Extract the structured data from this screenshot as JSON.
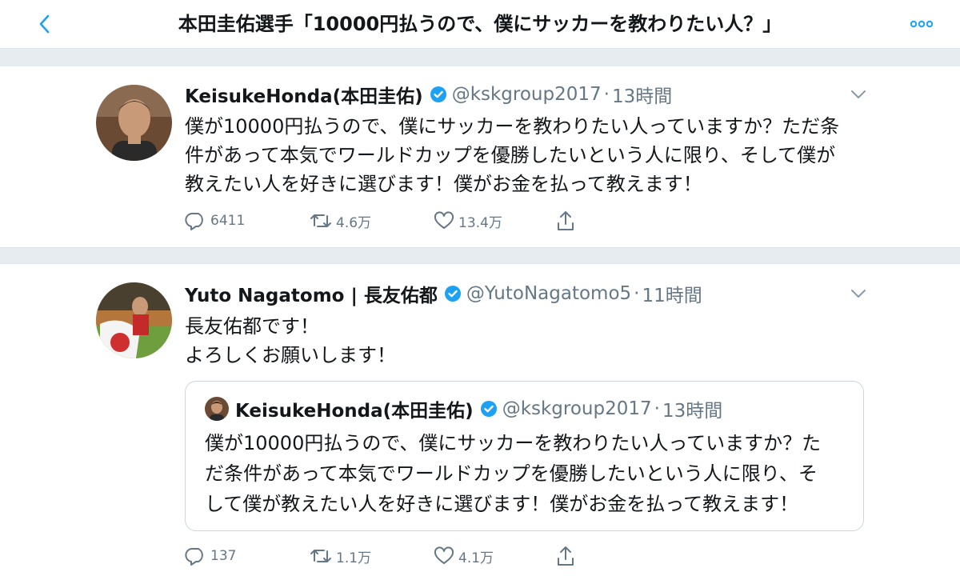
{
  "header": {
    "title": "本田圭佑選手「10000円払うので、僕にサッカーを教わりたい人？」",
    "back_icon": "chevron-left-icon",
    "more_icon": "more-dots-icon",
    "accent": "#1da1f2"
  },
  "tweets": [
    {
      "name": "KeisukeHonda(本田圭佑)",
      "handle": "@kskgroup2017",
      "separator": "·",
      "time": "13時間",
      "lines": [
        "僕が10000円払うので、僕にサッカーを教わりたい人っていますか？ただ条",
        "件があって本気でワールドカップを優勝したいという人に限り、そして僕が",
        "教えたい人を好きに選びます！僕がお金を払って教えます！"
      ],
      "replies": "6411",
      "retweets": "4.6万",
      "likes": "13.4万"
    },
    {
      "name": "Yuto Nagatomo | 長友佑都",
      "handle": "@YutoNagatomo5",
      "separator": "·",
      "time": "11時間",
      "lines": [
        "長友佑都です！",
        "よろしくお願いします！"
      ],
      "replies": "137",
      "retweets": "1.1万",
      "likes": "4.1万",
      "quote": {
        "name": "KeisukeHonda(本田圭佑)",
        "handle": "@kskgroup2017",
        "separator": "·",
        "time": "13時間",
        "lines": [
          "僕が10000円払うので、僕にサッカーを教わりたい人っていますか？た",
          "だ条件があって本気でワールドカップを優勝したいという人に限り、そ",
          "して僕が教えたい人を好きに選びます！僕がお金を払って教えます！"
        ]
      }
    }
  ]
}
